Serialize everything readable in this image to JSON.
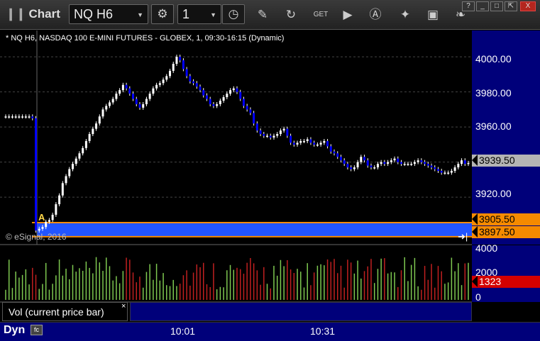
{
  "toolbar": {
    "app_title": "Chart",
    "symbol": "NQ H6",
    "interval": "1",
    "icons": [
      "settings-icon",
      "clock-icon",
      "draw-pencil-icon",
      "refresh-icon",
      "get-icon",
      "play-icon",
      "alert-icon",
      "link-icon",
      "photo-icon",
      "twitter-icon"
    ]
  },
  "window_buttons": {
    "help": "?",
    "minimize": "_",
    "maximize": "□",
    "close": "X"
  },
  "chart": {
    "header": "* NQ H6, NASDAQ 100 E-MINI FUTURES - GLOBEX, 1, 09:30-16:15 (Dynamic)",
    "copyright": "© eSignal, 2016",
    "price_ticks": [
      "4000.00",
      "3980.00",
      "3960.00",
      "3940.00",
      "3920.00"
    ],
    "last_price": "3939.50",
    "range_high": "3905.50",
    "range_low": "3897.50",
    "marker_label": "A",
    "colors": {
      "up": "#ffffff",
      "down": "#0000ff",
      "range_band": "#2255ff",
      "range_line": "#f58a00"
    }
  },
  "volume": {
    "label": "Vol (current price bar)",
    "close": "×",
    "ticks": [
      "4000",
      "2000",
      "0"
    ],
    "current": "1323"
  },
  "time_axis": {
    "dyn": "Dyn",
    "ticks": [
      "10:01",
      "10:31"
    ]
  },
  "chart_data": {
    "type": "candlestick",
    "title": "NQ H6, NASDAQ 100 E-MINI FUTURES - GLOBEX, 1, 09:30-16:15 (Dynamic)",
    "ylim": [
      3893,
      4015
    ],
    "x_ticks": [
      "10:01",
      "10:31"
    ],
    "closes": [
      3966,
      3966,
      3966,
      3966,
      3966,
      3966,
      3966,
      3966,
      3965,
      3901,
      3902,
      3903,
      3906,
      3907,
      3910,
      3916,
      3921,
      3928,
      3932,
      3936,
      3939,
      3942,
      3945,
      3948,
      3952,
      3956,
      3959,
      3962,
      3966,
      3970,
      3972,
      3974,
      3976,
      3979,
      3981,
      3984,
      3982,
      3979,
      3976,
      3973,
      3971,
      3973,
      3976,
      3979,
      3982,
      3984,
      3985,
      3987,
      3989,
      3992,
      3996,
      4000,
      3998,
      3993,
      3989,
      3986,
      3985,
      3983,
      3981,
      3978,
      3976,
      3973,
      3972,
      3973,
      3975,
      3977,
      3979,
      3981,
      3982,
      3980,
      3976,
      3972,
      3970,
      3968,
      3962,
      3958,
      3956,
      3955,
      3955,
      3954,
      3955,
      3956,
      3958,
      3959,
      3955,
      3951,
      3950,
      3951,
      3952,
      3952,
      3953,
      3951,
      3950,
      3950,
      3951,
      3952,
      3949,
      3946,
      3945,
      3943,
      3941,
      3939,
      3937,
      3936,
      3937,
      3940,
      3943,
      3941,
      3938,
      3937,
      3937,
      3939,
      3940,
      3939,
      3940,
      3941,
      3942,
      3940,
      3939,
      3939,
      3939,
      3939,
      3940,
      3941,
      3940,
      3939,
      3938,
      3937,
      3936,
      3935,
      3934,
      3934,
      3934,
      3935,
      3937,
      3939,
      3941,
      3939,
      3939.5
    ],
    "volume_max": 4000,
    "volume_ticks": [
      4000,
      2000,
      0
    ],
    "volume_current": 1323
  }
}
